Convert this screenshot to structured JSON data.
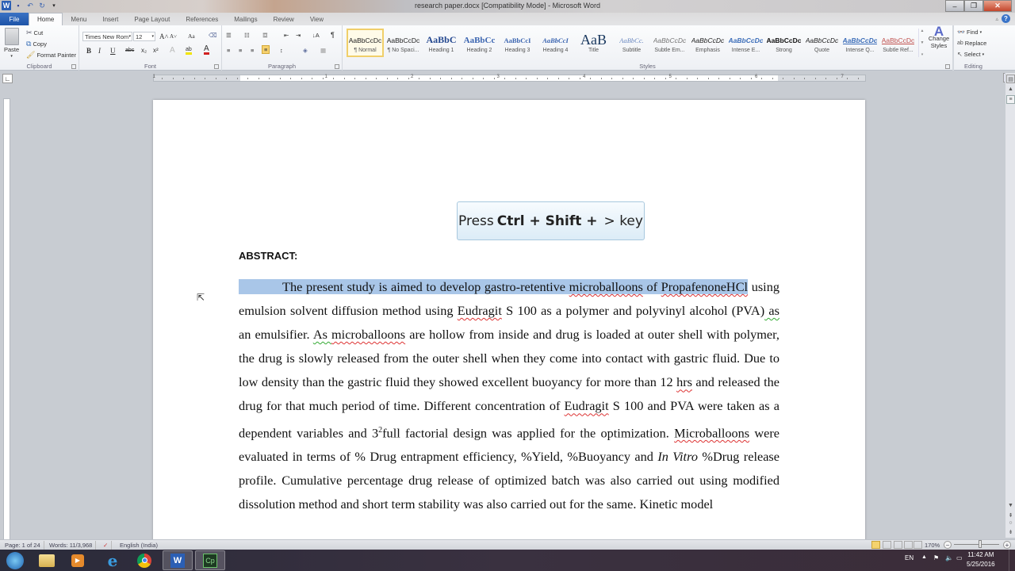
{
  "window": {
    "title": "research paper.docx [Compatibility Mode] - Microsoft Word",
    "controls": {
      "minimize": "–",
      "maximize": "❐",
      "close": "✕"
    }
  },
  "quick_access": [
    {
      "icon": "word-app-icon",
      "glyph": "W"
    },
    {
      "icon": "save-icon",
      "glyph": "💾"
    },
    {
      "icon": "undo-icon",
      "glyph": "↶"
    },
    {
      "icon": "redo-icon",
      "glyph": "↻"
    },
    {
      "icon": "customize-qat-icon",
      "glyph": "▾"
    }
  ],
  "tabs": [
    "File",
    "Home",
    "Menu",
    "Insert",
    "Page Layout",
    "References",
    "Mailings",
    "Review",
    "View"
  ],
  "active_tab": "Home",
  "ribbon": {
    "clipboard": {
      "label": "Clipboard",
      "paste": "Paste",
      "cut": "Cut",
      "copy": "Copy",
      "format_painter": "Format Painter"
    },
    "font": {
      "label": "Font",
      "font_name": "Times New Rom",
      "font_size": "12",
      "grow": "A˄",
      "shrink": "A˅",
      "change_case": "Aa",
      "clear": "⌫",
      "bold": "B",
      "italic": "I",
      "underline": "U",
      "strike": "abc",
      "subscript": "x₂",
      "superscript": "x²",
      "text_effects": "A",
      "highlight": "ab",
      "font_color": "A",
      "font_color_hex": "#d12020",
      "highlight_hex": "#f2e400"
    },
    "paragraph": {
      "label": "Paragraph",
      "bullets": "☰",
      "numbering": "☷",
      "multilevel": "☲",
      "decrease_indent": "⇤",
      "increase_indent": "⇥",
      "sort": "↓A",
      "show_marks": "¶",
      "align_left": "≡",
      "center": "≡",
      "align_right": "≡",
      "justify": "≡",
      "line_spacing": "↕",
      "shading": "◈",
      "borders": "▦"
    },
    "styles": {
      "label": "Styles",
      "items": [
        {
          "sample": "AaBbCcDc",
          "name": "¶ Normal",
          "selected": true
        },
        {
          "sample": "AaBbCcDc",
          "name": "¶ No Spaci..."
        },
        {
          "sample": "AaBbC",
          "name": "Heading 1"
        },
        {
          "sample": "AaBbCc",
          "name": "Heading 2"
        },
        {
          "sample": "AaBbCcI",
          "name": "Heading 3"
        },
        {
          "sample": "AaBbCcI",
          "name": "Heading 4"
        },
        {
          "sample": "AaB",
          "name": "Title"
        },
        {
          "sample": "AaBbCc.",
          "name": "Subtitle"
        },
        {
          "sample": "AaBbCcDc",
          "name": "Subtle Em..."
        },
        {
          "sample": "AaBbCcDc",
          "name": "Emphasis"
        },
        {
          "sample": "AaBbCcDc",
          "name": "Intense E..."
        },
        {
          "sample": "AaBbCcDc",
          "name": "Strong"
        },
        {
          "sample": "AaBbCcDc",
          "name": "Quote"
        },
        {
          "sample": "AaBbCcDc",
          "name": "Intense Q..."
        },
        {
          "sample": "AaBbCcDc",
          "name": "Subtle Ref..."
        }
      ],
      "change_styles": "Change Styles"
    },
    "editing": {
      "label": "Editing",
      "find": "Find",
      "replace": "Replace",
      "select": "Select"
    }
  },
  "ruler": {
    "numbers": [
      "1",
      "1",
      "2",
      "3",
      "4",
      "5",
      "6",
      "7"
    ]
  },
  "tooltip": {
    "prefix": "Press",
    "keys": "Ctrl + Shift +",
    "suffix": "> key"
  },
  "document": {
    "heading": "ABSTRACT:",
    "paragraph": {
      "selected": "The present study is aimed to develop gastro-retentive microballoons of PropafenoneHCl",
      "s1": "The present study is aimed to develop gastro-retentive ",
      "s2": "microballoons",
      "s3": " of ",
      "s4": "PropafenoneHCl",
      "t1": " using emulsion solvent diffusion method using ",
      "t2": "Eudragit",
      "t3": " S 100 as a polymer and polyvinyl alcohol (PVA)",
      "t4": "  as",
      "t5": " an emulsifier. ",
      "t6": "As ",
      "t7": " microballoons",
      "t8": " are hollow from inside and drug is loaded at outer shell with polymer, the drug is slowly released from the outer shell when they come into contact with gastric fluid. Due to low density than the gastric fluid they showed excellent buoyancy for more than 12 ",
      "t9": "hrs",
      "t10": " and released the drug for that much period of time. Different concentration of ",
      "t11": "Eudragit",
      "t12": " S 100 and PVA were taken as a dependent variables and 3",
      "t13": "2",
      "t14": "full factorial design was applied for the optimization. ",
      "t15": "Microballoons",
      "t16": " were evaluated in terms of % Drug entrapment efficiency, %Yield, %Buoyancy and ",
      "t17": "In Vitro",
      "t18": " %Drug release profile. Cumulative percentage drug release of optimized batch was also carried out using modified dissolution method and short term stability was also carried out for the same. Kinetic model"
    }
  },
  "status_bar": {
    "page": "Page: 1 of 24",
    "words": "Words: 11/3,968",
    "language": "English (India)",
    "zoom": "170%",
    "zoom_percent": 170
  },
  "taskbar": {
    "apps": [
      "start",
      "file-explorer",
      "media-player",
      "internet-explorer",
      "chrome",
      "word",
      "captivate"
    ],
    "captivate_label": "Cp",
    "word_label": "W",
    "lang": "EN",
    "time": "11:42 AM",
    "date": "5/25/2016"
  }
}
